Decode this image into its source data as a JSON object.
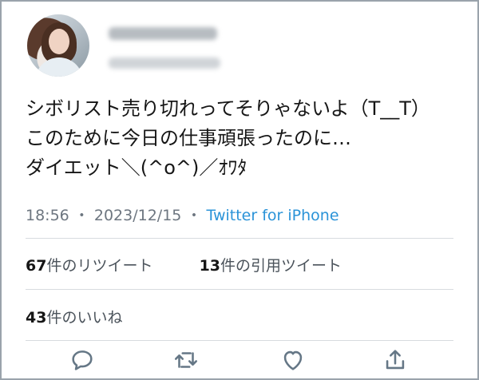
{
  "tweet": {
    "lines": [
      "シボリスト売り切れってそりゃないよ（T__T）",
      "このために今日の仕事頑張ったのに…",
      "ダイエット＼(^o^)／ｵﾜﾀ"
    ],
    "time": "18:56",
    "date": "2023/12/15",
    "separator": "・",
    "source": "Twitter for iPhone"
  },
  "stats": {
    "retweets_count": "67",
    "retweets_label": "件のリツイート",
    "quotes_count": "13",
    "quotes_label": "件の引用ツイート",
    "likes_count": "43",
    "likes_label": "件のいいね"
  },
  "actions": [
    {
      "name": "reply",
      "icon": "reply-icon"
    },
    {
      "name": "retweet",
      "icon": "retweet-icon"
    },
    {
      "name": "like",
      "icon": "heart-icon"
    },
    {
      "name": "share",
      "icon": "share-icon"
    }
  ],
  "colors": {
    "accent": "#2a93d8",
    "text": "#161616",
    "muted": "#6d7680",
    "icon": "#657786",
    "border": "#9aa3ab"
  }
}
